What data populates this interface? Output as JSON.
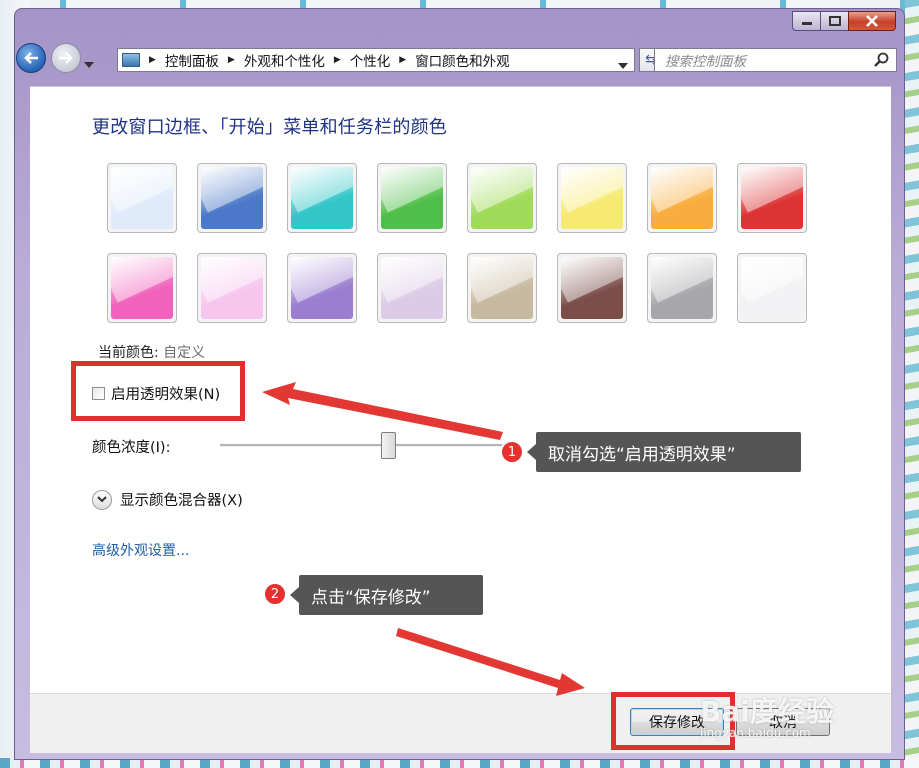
{
  "window": {
    "buttons": {
      "minimize": "minimize",
      "maximize": "maximize",
      "close": "close"
    }
  },
  "nav": {
    "breadcrumbs": [
      "控制面板",
      "外观和个性化",
      "个性化",
      "窗口颜色和外观"
    ],
    "search_placeholder": "搜索控制面板"
  },
  "main": {
    "title": "更改窗口边框、「开始」菜单和任务栏的颜色",
    "swatches": [
      {
        "name": "sky",
        "color": "#dfeafb"
      },
      {
        "name": "twilight",
        "color": "#4b78c8"
      },
      {
        "name": "sea",
        "color": "#33c6c8"
      },
      {
        "name": "leaf",
        "color": "#4fbf49"
      },
      {
        "name": "lime",
        "color": "#9fdb59"
      },
      {
        "name": "lemon",
        "color": "#f7ea72"
      },
      {
        "name": "tangerine",
        "color": "#f8ad3e"
      },
      {
        "name": "ruby",
        "color": "#dc3333"
      },
      {
        "name": "fuchsia",
        "color": "#f062bb"
      },
      {
        "name": "blush",
        "color": "#f6c6ee"
      },
      {
        "name": "violet",
        "color": "#9b7ed0"
      },
      {
        "name": "lavender",
        "color": "#dccbe6"
      },
      {
        "name": "taupe",
        "color": "#c7b99f"
      },
      {
        "name": "chocolate",
        "color": "#7b4e4a"
      },
      {
        "name": "slate",
        "color": "#a7a7ab"
      },
      {
        "name": "frost",
        "color": "#f2f2f4"
      }
    ],
    "current_color_label": "当前颜色:",
    "current_color_value": "自定义",
    "transparency_label": "启用透明效果(N)",
    "transparency_checked": false,
    "intensity_label": "颜色浓度(I):",
    "intensity_value": 0.58,
    "mixer_label": "显示颜色混合器(X)",
    "advanced_link": "高级外观设置..."
  },
  "footer": {
    "save_label": "保存修改",
    "cancel_label": "取消"
  },
  "annotations": {
    "step1_number": "1",
    "step1_text": "取消勾选“启用透明效果”",
    "step2_number": "2",
    "step2_text": "点击“保存修改”",
    "highlight_color": "#e0302d",
    "watermark": "Bai度经验",
    "watermark_url": "jingyan.baidu.com"
  }
}
